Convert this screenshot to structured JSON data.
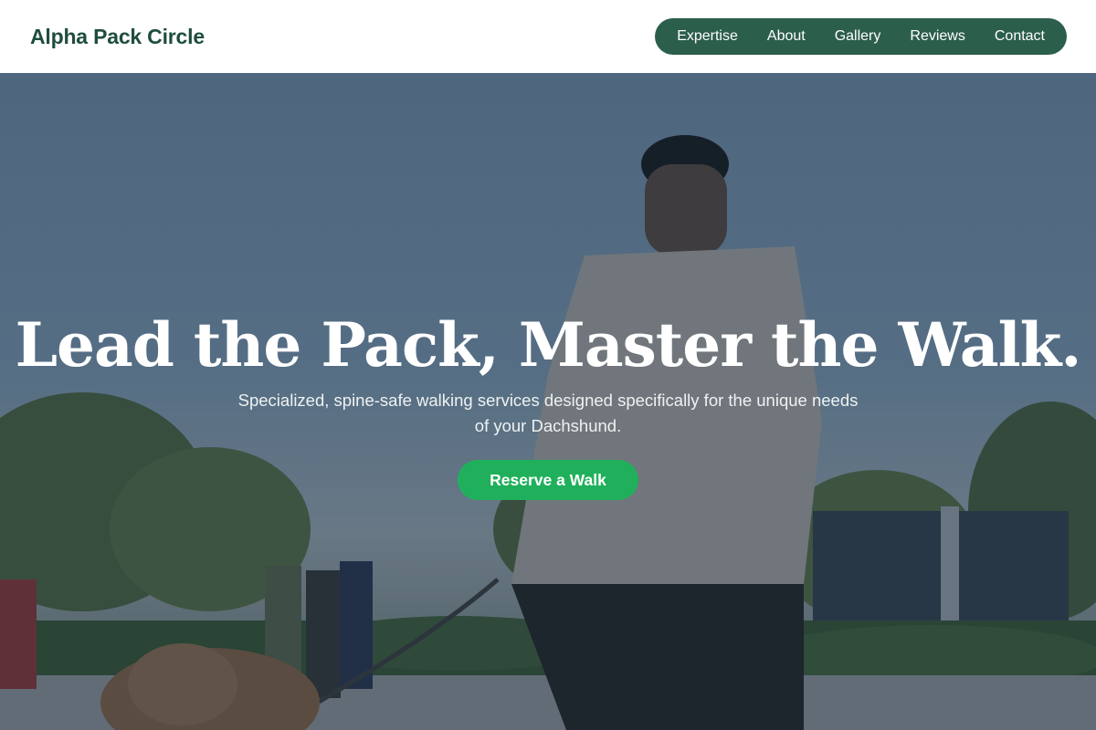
{
  "header": {
    "brand": "Alpha Pack Circle",
    "nav": [
      "Expertise",
      "About",
      "Gallery",
      "Reviews",
      "Contact"
    ]
  },
  "hero": {
    "title": "Lead the Pack, Master the Walk.",
    "subtitle": "Specialized, spine-safe walking services designed specifically for the unique needs of your Dachshund.",
    "cta_label": "Reserve a Walk",
    "background_image": "photo of a person walking a curly-haired dog on a leash along a waterfront path with people in the background"
  },
  "colors": {
    "brand_text": "#1f4d3f",
    "nav_bg": "#2c5e4c",
    "cta_bg": "#20b05c"
  }
}
